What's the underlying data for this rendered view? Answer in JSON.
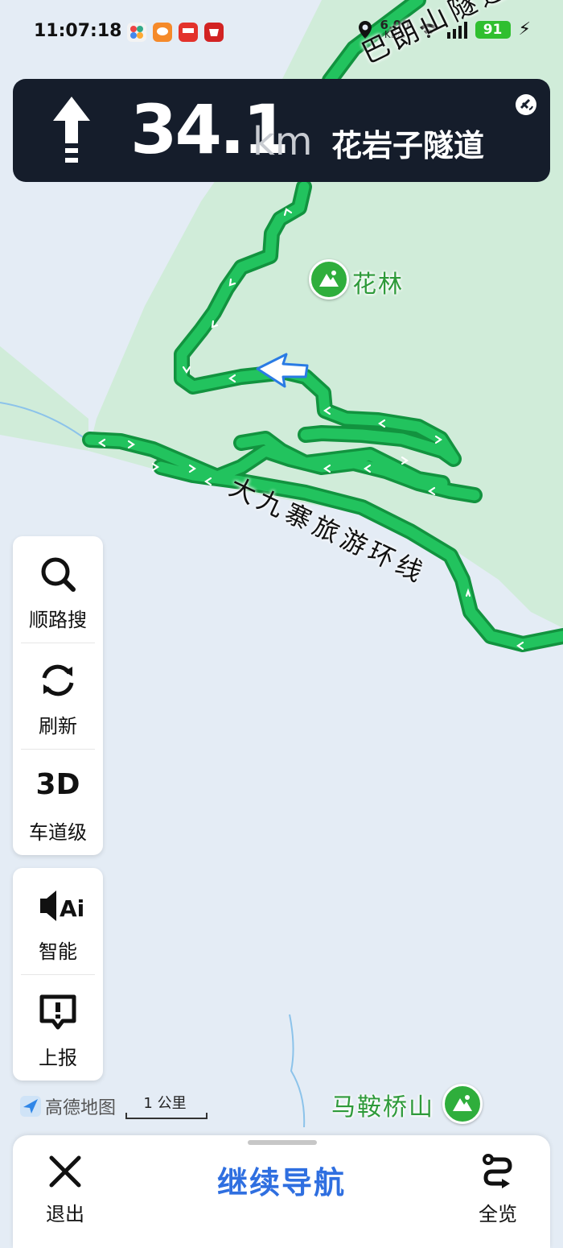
{
  "status_bar": {
    "time": "11:07:18",
    "net_speed": "6.00",
    "net_unit": "KB/s",
    "battery": "91",
    "colors": {
      "battery": "#2fbf2f"
    }
  },
  "nav_banner": {
    "distance": "34.1",
    "unit": "km",
    "road_name": "花岩子隧道",
    "turn_icon": "straight-arrow-icon"
  },
  "map": {
    "top_road_name": "巴朗山隧道",
    "poi_top": "花林",
    "road_name": "大九寨旅游环线",
    "poi_bottom": "马鞍桥山",
    "colors": {
      "route": "#22c35e",
      "route_edge": "#12933f",
      "land": "#d0ecd9",
      "water": "#e4ecf5"
    }
  },
  "side_panel": {
    "items": [
      {
        "label": "顺路搜",
        "icon": "search-icon"
      },
      {
        "label": "刷新",
        "icon": "refresh-icon"
      },
      {
        "icon_text": "3D",
        "label": "车道级",
        "icon": "3d-icon"
      }
    ]
  },
  "side_panel_2": {
    "items": [
      {
        "label": "智能",
        "icon_text": "Ai",
        "icon": "voice-ai-icon"
      },
      {
        "label": "上报",
        "icon": "report-icon"
      }
    ]
  },
  "footer": {
    "logo": "高德地图",
    "scale": "1 公里"
  },
  "bottom_bar": {
    "exit_label": "退出",
    "continue_label": "继续导航",
    "overview_label": "全览",
    "colors": {
      "continue": "#2f6fe0"
    }
  }
}
